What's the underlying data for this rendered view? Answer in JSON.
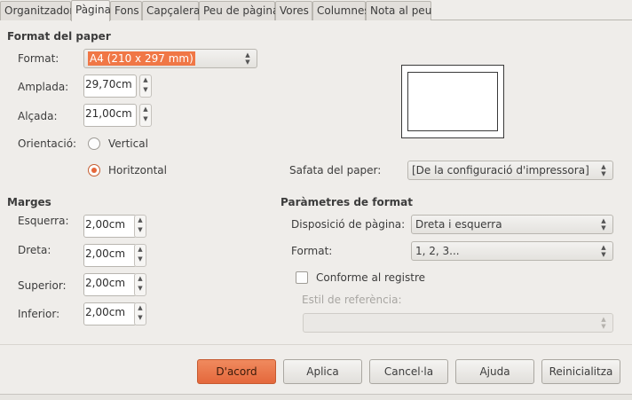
{
  "tabs": [
    "Organitzador",
    "Pàgina",
    "Fons",
    "Capçalera",
    "Peu de pàgina",
    "Vores",
    "Columnes",
    "Nota al peu"
  ],
  "active_tab": "Pàgina",
  "paper_format": {
    "title": "Format del paper",
    "format_label": "Format:",
    "format_value": "A4 (210 x 297 mm)",
    "width_label": "Amplada:",
    "width_value": "29,70cm",
    "height_label": "Alçada:",
    "height_value": "21,00cm",
    "orientation_label": "Orientació:",
    "vertical_label": "Vertical",
    "horizontal_label": "Horitzontal",
    "orientation_selected": "horizontal",
    "tray_label": "Safata del paper:",
    "tray_value": "[De la configuració d'impressora]"
  },
  "margins": {
    "title": "Marges",
    "left_label": "Esquerra:",
    "left_value": "2,00cm",
    "right_label": "Dreta:",
    "right_value": "2,00cm",
    "top_label": "Superior:",
    "top_value": "2,00cm",
    "bottom_label": "Inferior:",
    "bottom_value": "2,00cm"
  },
  "layout_settings": {
    "title": "Paràmetres de format",
    "page_layout_label": "Disposició de pàgina:",
    "page_layout_value": "Dreta i esquerra",
    "format_label": "Format:",
    "format_value": "1, 2, 3...",
    "register_label": "Conforme al registre",
    "register_checked": false,
    "reference_style_label": "Estil de referència:",
    "reference_style_value": ""
  },
  "buttons": {
    "ok": "D'acord",
    "apply": "Aplica",
    "cancel": "Cancel·la",
    "help": "Ajuda",
    "reset": "Reinicialitza"
  },
  "colors": {
    "accent": "#f07746",
    "background": "#efedea"
  }
}
